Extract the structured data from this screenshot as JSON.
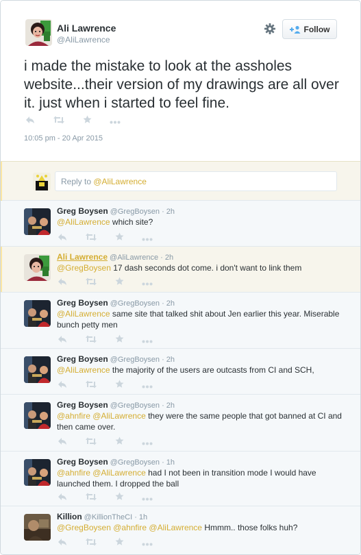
{
  "main_tweet": {
    "author_name": "Ali Lawrence",
    "author_handle": "@AliLawrence",
    "follow_label": "Follow",
    "text": "i made the mistake to look at the assholes website...their version of my drawings are all over it. just when i started to feel fine.",
    "timestamp": "10:05 pm - 20 Apr 2015"
  },
  "reply_box": {
    "prefix": "Reply to ",
    "mention": "@AliLawrence"
  },
  "replies": [
    {
      "name": "Greg Boysen",
      "handle": "@GregBoysen",
      "time": "2h",
      "mentions": "@AliLawrence",
      "text": " which site?"
    },
    {
      "name": "Ali Lawrence",
      "handle": "@AliLawrence",
      "time": "2h",
      "mentions": "@GregBoysen",
      "text": " 17 dash seconds dot come. i don't want to link them"
    },
    {
      "name": "Greg Boysen",
      "handle": "@GregBoysen",
      "time": "2h",
      "mentions": "@AliLawrence",
      "text": " same site that talked shit about Jen earlier this year. Miserable bunch petty men"
    },
    {
      "name": "Greg Boysen",
      "handle": "@GregBoysen",
      "time": "2h",
      "mentions": "@AliLawrence",
      "text": " the majority of the users are outcasts from CI and SCH,"
    },
    {
      "name": "Greg Boysen",
      "handle": "@GregBoysen",
      "time": "2h",
      "mentions": "@ahnfire @AliLawrence",
      "text": " they were the same people that got banned at CI and then came over."
    },
    {
      "name": "Greg Boysen",
      "handle": "@GregBoysen",
      "time": "1h",
      "mentions": "@ahnfire @AliLawrence",
      "text": " had I not been in transition mode I would have launched them. I dropped the ball"
    },
    {
      "name": "Killion",
      "handle": "@KillionTheCI",
      "time": "1h",
      "mentions": "@GregBoysen @ahnfire @AliLawrence",
      "text": " Hmmm.. those folks huh?"
    }
  ],
  "separator": " · ",
  "colors": {
    "mention": "#d4ad31",
    "reply_bg": "#f5f8fa",
    "highlight_bg": "#f7f5ec",
    "muted": "#8899a6"
  },
  "icons": [
    "gear-icon",
    "follow-person-icon",
    "reply-icon",
    "retweet-icon",
    "favorite-icon",
    "more-icon"
  ]
}
